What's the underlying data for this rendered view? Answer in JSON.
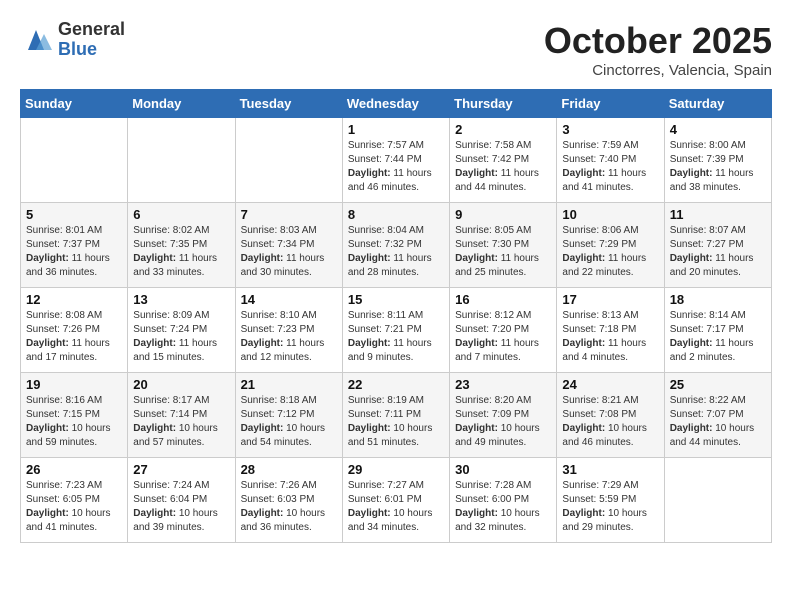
{
  "header": {
    "logo_general": "General",
    "logo_blue": "Blue",
    "month": "October 2025",
    "location": "Cinctorres, Valencia, Spain"
  },
  "weekdays": [
    "Sunday",
    "Monday",
    "Tuesday",
    "Wednesday",
    "Thursday",
    "Friday",
    "Saturday"
  ],
  "weeks": [
    [
      {
        "day": "",
        "info": ""
      },
      {
        "day": "",
        "info": ""
      },
      {
        "day": "",
        "info": ""
      },
      {
        "day": "1",
        "info": "Sunrise: 7:57 AM\nSunset: 7:44 PM\nDaylight: 11 hours and 46 minutes."
      },
      {
        "day": "2",
        "info": "Sunrise: 7:58 AM\nSunset: 7:42 PM\nDaylight: 11 hours and 44 minutes."
      },
      {
        "day": "3",
        "info": "Sunrise: 7:59 AM\nSunset: 7:40 PM\nDaylight: 11 hours and 41 minutes."
      },
      {
        "day": "4",
        "info": "Sunrise: 8:00 AM\nSunset: 7:39 PM\nDaylight: 11 hours and 38 minutes."
      }
    ],
    [
      {
        "day": "5",
        "info": "Sunrise: 8:01 AM\nSunset: 7:37 PM\nDaylight: 11 hours and 36 minutes."
      },
      {
        "day": "6",
        "info": "Sunrise: 8:02 AM\nSunset: 7:35 PM\nDaylight: 11 hours and 33 minutes."
      },
      {
        "day": "7",
        "info": "Sunrise: 8:03 AM\nSunset: 7:34 PM\nDaylight: 11 hours and 30 minutes."
      },
      {
        "day": "8",
        "info": "Sunrise: 8:04 AM\nSunset: 7:32 PM\nDaylight: 11 hours and 28 minutes."
      },
      {
        "day": "9",
        "info": "Sunrise: 8:05 AM\nSunset: 7:30 PM\nDaylight: 11 hours and 25 minutes."
      },
      {
        "day": "10",
        "info": "Sunrise: 8:06 AM\nSunset: 7:29 PM\nDaylight: 11 hours and 22 minutes."
      },
      {
        "day": "11",
        "info": "Sunrise: 8:07 AM\nSunset: 7:27 PM\nDaylight: 11 hours and 20 minutes."
      }
    ],
    [
      {
        "day": "12",
        "info": "Sunrise: 8:08 AM\nSunset: 7:26 PM\nDaylight: 11 hours and 17 minutes."
      },
      {
        "day": "13",
        "info": "Sunrise: 8:09 AM\nSunset: 7:24 PM\nDaylight: 11 hours and 15 minutes."
      },
      {
        "day": "14",
        "info": "Sunrise: 8:10 AM\nSunset: 7:23 PM\nDaylight: 11 hours and 12 minutes."
      },
      {
        "day": "15",
        "info": "Sunrise: 8:11 AM\nSunset: 7:21 PM\nDaylight: 11 hours and 9 minutes."
      },
      {
        "day": "16",
        "info": "Sunrise: 8:12 AM\nSunset: 7:20 PM\nDaylight: 11 hours and 7 minutes."
      },
      {
        "day": "17",
        "info": "Sunrise: 8:13 AM\nSunset: 7:18 PM\nDaylight: 11 hours and 4 minutes."
      },
      {
        "day": "18",
        "info": "Sunrise: 8:14 AM\nSunset: 7:17 PM\nDaylight: 11 hours and 2 minutes."
      }
    ],
    [
      {
        "day": "19",
        "info": "Sunrise: 8:16 AM\nSunset: 7:15 PM\nDaylight: 10 hours and 59 minutes."
      },
      {
        "day": "20",
        "info": "Sunrise: 8:17 AM\nSunset: 7:14 PM\nDaylight: 10 hours and 57 minutes."
      },
      {
        "day": "21",
        "info": "Sunrise: 8:18 AM\nSunset: 7:12 PM\nDaylight: 10 hours and 54 minutes."
      },
      {
        "day": "22",
        "info": "Sunrise: 8:19 AM\nSunset: 7:11 PM\nDaylight: 10 hours and 51 minutes."
      },
      {
        "day": "23",
        "info": "Sunrise: 8:20 AM\nSunset: 7:09 PM\nDaylight: 10 hours and 49 minutes."
      },
      {
        "day": "24",
        "info": "Sunrise: 8:21 AM\nSunset: 7:08 PM\nDaylight: 10 hours and 46 minutes."
      },
      {
        "day": "25",
        "info": "Sunrise: 8:22 AM\nSunset: 7:07 PM\nDaylight: 10 hours and 44 minutes."
      }
    ],
    [
      {
        "day": "26",
        "info": "Sunrise: 7:23 AM\nSunset: 6:05 PM\nDaylight: 10 hours and 41 minutes."
      },
      {
        "day": "27",
        "info": "Sunrise: 7:24 AM\nSunset: 6:04 PM\nDaylight: 10 hours and 39 minutes."
      },
      {
        "day": "28",
        "info": "Sunrise: 7:26 AM\nSunset: 6:03 PM\nDaylight: 10 hours and 36 minutes."
      },
      {
        "day": "29",
        "info": "Sunrise: 7:27 AM\nSunset: 6:01 PM\nDaylight: 10 hours and 34 minutes."
      },
      {
        "day": "30",
        "info": "Sunrise: 7:28 AM\nSunset: 6:00 PM\nDaylight: 10 hours and 32 minutes."
      },
      {
        "day": "31",
        "info": "Sunrise: 7:29 AM\nSunset: 5:59 PM\nDaylight: 10 hours and 29 minutes."
      },
      {
        "day": "",
        "info": ""
      }
    ]
  ]
}
